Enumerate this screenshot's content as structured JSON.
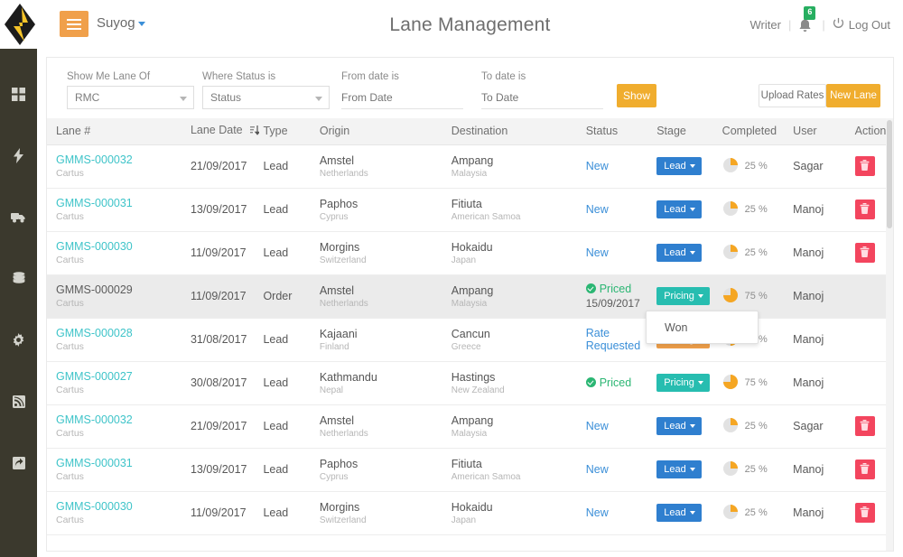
{
  "app": {
    "logo_name": "diamond-logo",
    "burger_label": "menu-toggle",
    "user_menu": "Suyog",
    "page_title": "Lane Management",
    "role": "Writer",
    "notification_count": "6",
    "logout_label": "Log Out"
  },
  "colors": {
    "accent_orange": "#f0ad2e",
    "link_teal": "#3fc4c9",
    "status_blue": "#3b8fd8",
    "status_green": "#2bb673",
    "stage_blue": "#2f7fcf",
    "stage_teal": "#27bdb0",
    "stage_orange": "#f0a04b",
    "danger_red": "#f3455e",
    "sidebar_bg": "#3b392d"
  },
  "sidebar": {
    "items": [
      {
        "icon": "dashboard-grid-icon",
        "name": "sidebar-item-dashboard"
      },
      {
        "icon": "lightning-bolt-icon",
        "name": "sidebar-item-activity"
      },
      {
        "icon": "truck-icon",
        "name": "sidebar-item-shipments"
      },
      {
        "icon": "database-icon",
        "name": "sidebar-item-data"
      },
      {
        "icon": "gear-icon",
        "name": "sidebar-item-settings"
      },
      {
        "icon": "rss-icon",
        "name": "sidebar-item-feed"
      },
      {
        "icon": "share-export-icon",
        "name": "sidebar-item-export"
      }
    ]
  },
  "filters": {
    "lane_of_label": "Show Me Lane Of",
    "lane_of_value": "RMC",
    "status_label": "Where Status is",
    "status_value": "Status",
    "from_label": "From date is",
    "from_placeholder": "From Date",
    "from_value": "",
    "to_label": "To date is",
    "to_placeholder": "To Date",
    "to_value": "",
    "show_button": "Show",
    "upload_button": "Upload Rates",
    "new_lane_button": "New Lane"
  },
  "table": {
    "headers": {
      "lane": "Lane #",
      "lane_date": "Lane Date",
      "type": "Type",
      "origin": "Origin",
      "destination": "Destination",
      "status": "Status",
      "stage": "Stage",
      "completed": "Completed",
      "user": "User",
      "action": "Action"
    },
    "sort_icon": "sort-descending-icon",
    "rows": [
      {
        "lane": "GMMS-000032",
        "lane_link": true,
        "account": "Cartus",
        "date": "21/09/2017",
        "type": "Lead",
        "origin_city": "Amstel",
        "origin_country": "Netherlands",
        "dest_city": "Ampang",
        "dest_country": "Malaysia",
        "status": "New",
        "status_kind": "link",
        "status_date": "",
        "stage": "Lead",
        "stage_color": "blue",
        "completed": "25 %",
        "percent": 25,
        "user": "Sagar",
        "has_delete": true,
        "highlighted": false
      },
      {
        "lane": "GMMS-000031",
        "lane_link": true,
        "account": "Cartus",
        "date": "13/09/2017",
        "type": "Lead",
        "origin_city": "Paphos",
        "origin_country": "Cyprus",
        "dest_city": "Fitiuta",
        "dest_country": "American Samoa",
        "status": "New",
        "status_kind": "link",
        "status_date": "",
        "stage": "Lead",
        "stage_color": "blue",
        "completed": "25 %",
        "percent": 25,
        "user": "Manoj",
        "has_delete": true,
        "highlighted": false
      },
      {
        "lane": "GMMS-000030",
        "lane_link": true,
        "account": "Cartus",
        "date": "11/09/2017",
        "type": "Lead",
        "origin_city": "Morgins",
        "origin_country": "Switzerland",
        "dest_city": "Hokaidu",
        "dest_country": "Japan",
        "status": "New",
        "status_kind": "link",
        "status_date": "",
        "stage": "Lead",
        "stage_color": "blue",
        "completed": "25 %",
        "percent": 25,
        "user": "Manoj",
        "has_delete": true,
        "highlighted": false
      },
      {
        "lane": "GMMS-000029",
        "lane_link": false,
        "account": "Cartus",
        "date": "11/09/2017",
        "type": "Order",
        "origin_city": "Amstel",
        "origin_country": "Netherlands",
        "dest_city": "Ampang",
        "dest_country": "Malaysia",
        "status": "Priced",
        "status_kind": "priced",
        "status_date": "15/09/2017",
        "stage": "Pricing",
        "stage_color": "teal",
        "completed": "75 %",
        "percent": 75,
        "user": "Manoj",
        "has_delete": false,
        "highlighted": true
      },
      {
        "lane": "GMMS-000028",
        "lane_link": true,
        "account": "Cartus",
        "date": "31/08/2017",
        "type": "Lead",
        "origin_city": "Kajaani",
        "origin_country": "Finland",
        "dest_city": "Cancun",
        "dest_country": "Greece",
        "status": "Rate Requested",
        "status_kind": "link",
        "status_date": "",
        "stage": "Pricing",
        "stage_color": "orange",
        "completed": "50 %",
        "percent": 50,
        "user": "Manoj",
        "has_delete": false,
        "highlighted": false
      },
      {
        "lane": "GMMS-000027",
        "lane_link": true,
        "account": "Cartus",
        "date": "30/08/2017",
        "type": "Lead",
        "origin_city": "Kathmandu",
        "origin_country": "Nepal",
        "dest_city": "Hastings",
        "dest_country": "New Zealand",
        "status": "Priced",
        "status_kind": "priced",
        "status_date": "",
        "stage": "Pricing",
        "stage_color": "teal",
        "completed": "75 %",
        "percent": 75,
        "user": "Manoj",
        "has_delete": false,
        "highlighted": false
      },
      {
        "lane": "GMMS-000032",
        "lane_link": true,
        "account": "Cartus",
        "date": "21/09/2017",
        "type": "Lead",
        "origin_city": "Amstel",
        "origin_country": "Netherlands",
        "dest_city": "Ampang",
        "dest_country": "Malaysia",
        "status": "New",
        "status_kind": "link",
        "status_date": "",
        "stage": "Lead",
        "stage_color": "blue",
        "completed": "25 %",
        "percent": 25,
        "user": "Sagar",
        "has_delete": true,
        "highlighted": false
      },
      {
        "lane": "GMMS-000031",
        "lane_link": true,
        "account": "Cartus",
        "date": "13/09/2017",
        "type": "Lead",
        "origin_city": "Paphos",
        "origin_country": "Cyprus",
        "dest_city": "Fitiuta",
        "dest_country": "American Samoa",
        "status": "New",
        "status_kind": "link",
        "status_date": "",
        "stage": "Lead",
        "stage_color": "blue",
        "completed": "25 %",
        "percent": 25,
        "user": "Manoj",
        "has_delete": true,
        "highlighted": false
      },
      {
        "lane": "GMMS-000030",
        "lane_link": true,
        "account": "Cartus",
        "date": "11/09/2017",
        "type": "Lead",
        "origin_city": "Morgins",
        "origin_country": "Switzerland",
        "dest_city": "Hokaidu",
        "dest_country": "Japan",
        "status": "New",
        "status_kind": "link",
        "status_date": "",
        "stage": "Lead",
        "stage_color": "blue",
        "completed": "25 %",
        "percent": 25,
        "user": "Manoj",
        "has_delete": true,
        "highlighted": false
      }
    ]
  },
  "stage_dropdown": {
    "open": true,
    "items": [
      "Won"
    ]
  }
}
